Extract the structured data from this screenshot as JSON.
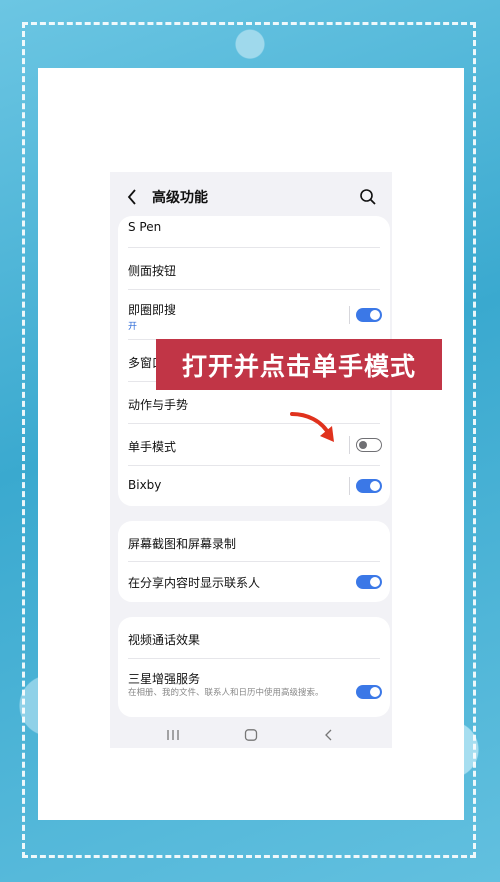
{
  "header": {
    "title": "高级功能",
    "back_icon": "chevron-left-icon",
    "search_icon": "search-icon"
  },
  "group1": {
    "items": [
      {
        "label": "S Pen"
      },
      {
        "label": "侧面按钮"
      },
      {
        "label": "即圈即搜",
        "sub": "开",
        "toggle": "on"
      },
      {
        "label": "多窗口"
      },
      {
        "label": "动作与手势"
      },
      {
        "label": "单手模式",
        "toggle": "off"
      },
      {
        "label": "Bixby",
        "toggle": "on"
      }
    ]
  },
  "group2": {
    "items": [
      {
        "label": "屏幕截图和屏幕录制"
      },
      {
        "label": "在分享内容时显示联系人",
        "toggle": "on"
      }
    ]
  },
  "group3": {
    "items": [
      {
        "label": "视频通话效果"
      },
      {
        "label": "三星增强服务",
        "desc": "在相册、我的文件、联系人和日历中使用高级搜索。",
        "toggle": "on"
      }
    ]
  },
  "navbar": {
    "icons": [
      "recent-apps-icon",
      "home-icon",
      "back-icon"
    ]
  },
  "overlay": {
    "banner_text": "打开并点击单手模式",
    "banner_color": "#c13546",
    "arrow_color": "#e0321d"
  },
  "colors": {
    "accent": "#3b78e7",
    "background": "#f2f2f6"
  }
}
